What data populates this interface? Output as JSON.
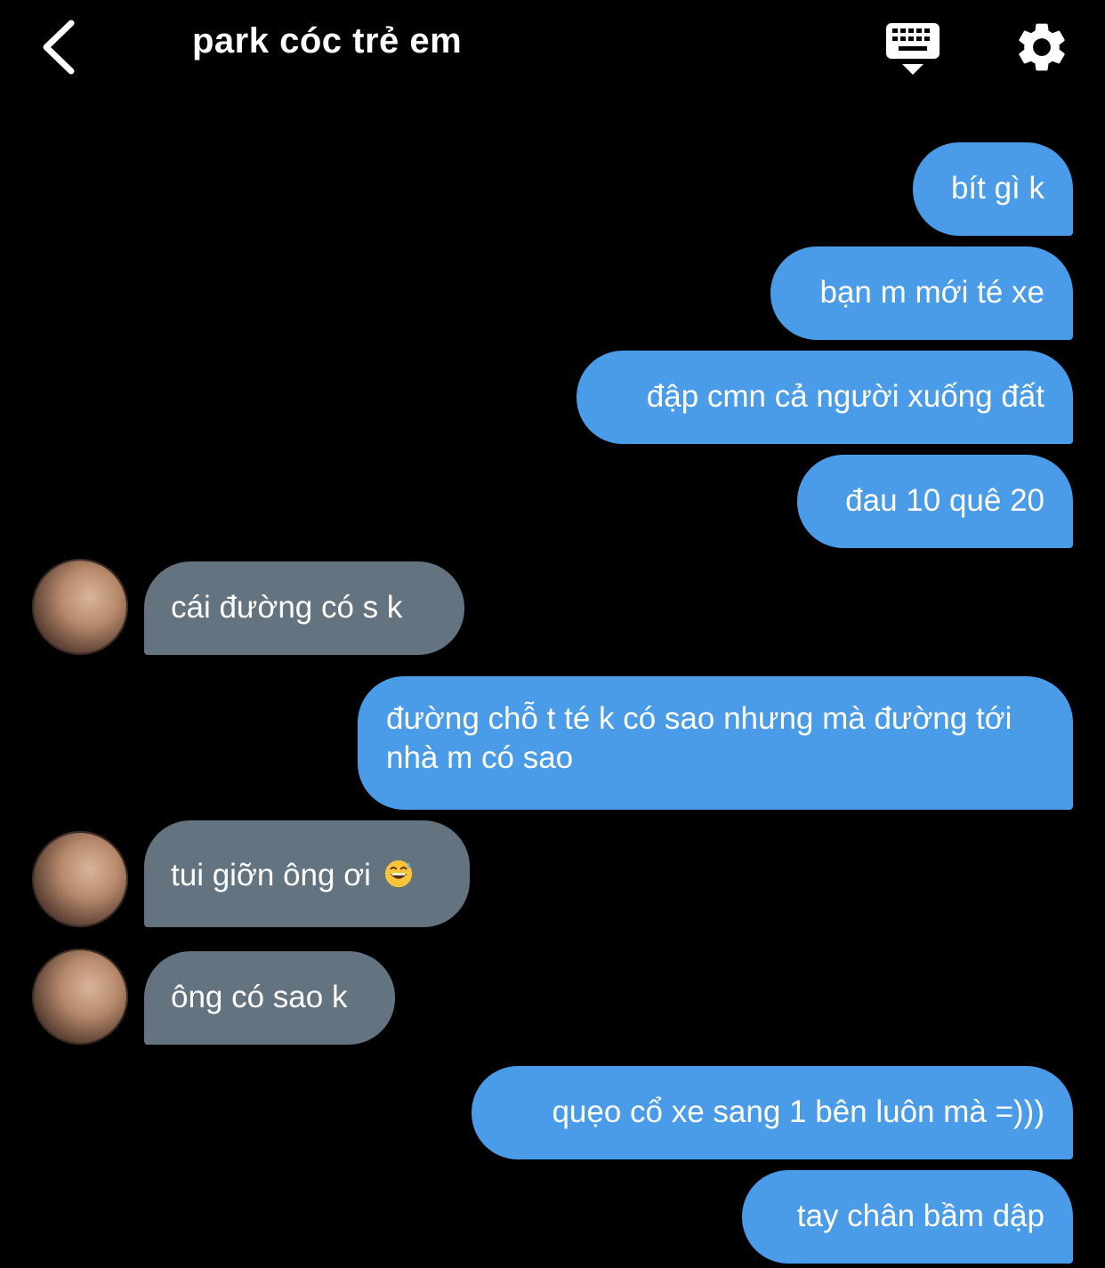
{
  "header": {
    "title": "park cóc trẻ em",
    "back_icon": "chevron-left-icon",
    "keyboard_icon": "keyboard-hide-icon",
    "settings_icon": "gear-icon"
  },
  "colors": {
    "background": "#000000",
    "sent_bubble": "#4a9be8",
    "received_bubble": "#647380",
    "text": "#ffffff"
  },
  "messages": [
    {
      "from": "me",
      "text": "bít gì k"
    },
    {
      "from": "me",
      "text": "bạn m mới té xe"
    },
    {
      "from": "me",
      "text": "đập cmn cả người xuống đất"
    },
    {
      "from": "me",
      "text": "đau 10 quê 20"
    },
    {
      "from": "them",
      "text": "cái đường có s k"
    },
    {
      "from": "me",
      "text": "đường chỗ t té k có sao nhưng mà đường tới nhà m có sao"
    },
    {
      "from": "them",
      "text": "tui giỡn ông ơi",
      "emoji": "grinning-sweat-emoji"
    },
    {
      "from": "them",
      "text": "ông có sao k"
    },
    {
      "from": "me",
      "text": "quẹo cổ xe sang 1 bên luôn mà =)))"
    },
    {
      "from": "me",
      "text": "tay chân bầm dập"
    }
  ]
}
